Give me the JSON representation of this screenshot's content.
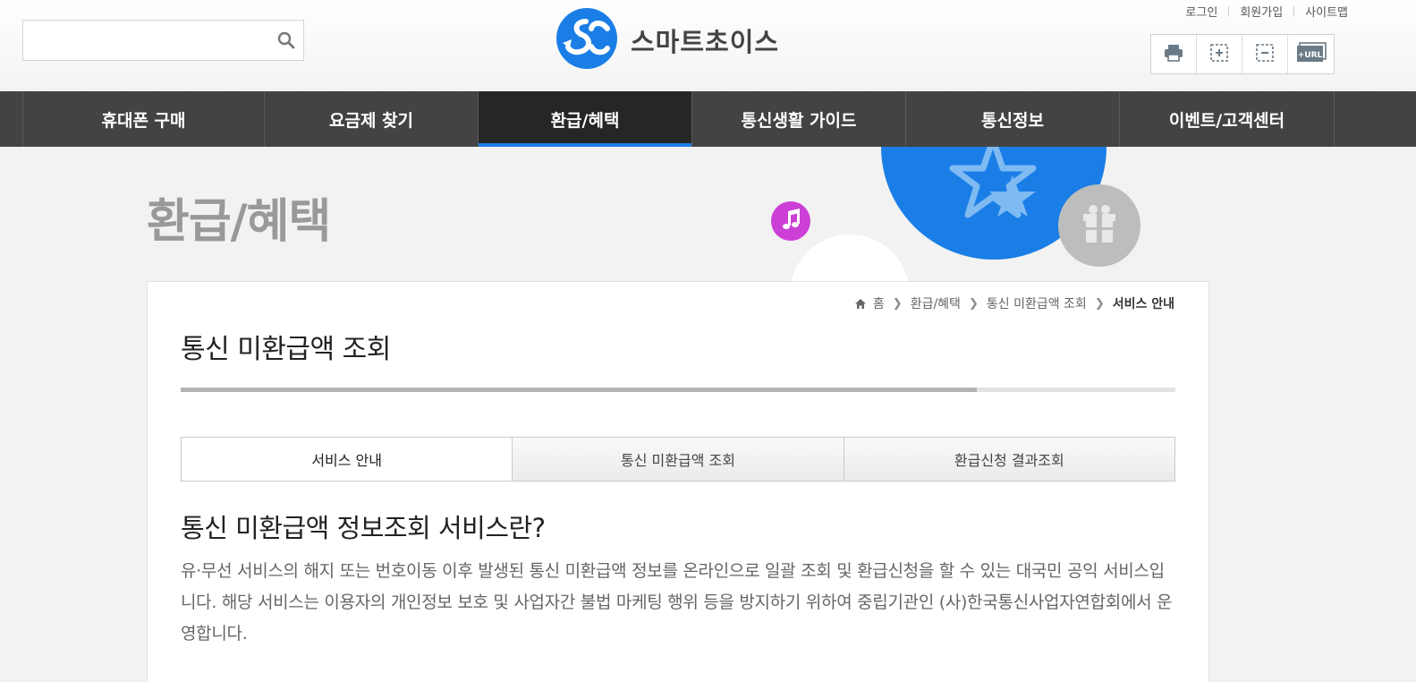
{
  "header": {
    "search": {
      "placeholder": "",
      "value": ""
    },
    "logo": {
      "text": "스마트초이스"
    },
    "util_links": [
      "로그인",
      "회원가입",
      "사이트맵"
    ],
    "tool_icons": [
      "print-icon",
      "zoom-in-icon",
      "zoom-out-icon",
      "url-copy-icon"
    ],
    "url_badge": "+URL"
  },
  "nav": {
    "items": [
      {
        "label": "휴대폰 구매"
      },
      {
        "label": "요금제 찾기"
      },
      {
        "label": "환급/혜택"
      },
      {
        "label": "통신생활 가이드"
      },
      {
        "label": "통신정보"
      },
      {
        "label": "이벤트/고객센터"
      }
    ],
    "active_index": 2
  },
  "visual": {
    "title": "환급/혜택"
  },
  "breadcrumb": {
    "items": [
      "홈",
      "환급/혜택",
      "통신 미환급액 조회",
      "서비스 안내"
    ]
  },
  "content": {
    "title": "통신 미환급액 조회",
    "progress": 0.8,
    "tabs": [
      {
        "label": "서비스 안내"
      },
      {
        "label": "통신 미환급액 조회"
      },
      {
        "label": "환급신청 결과조회"
      }
    ],
    "active_tab": 0,
    "section_title": "통신 미환급액 정보조회 서비스란?",
    "description": "유·무선 서비스의 해지 또는 번호이동 이후 발생된 통신 미환급액 정보를 온라인으로 일괄 조회 및 환급신청을 할 수 있는 대국민 공익 서비스입니다. 해당 서비스는 이용자의 개인정보 보호 및 사업자간 불법 마케팅 행위 등을 방지하기 위하여 중립기관인 (사)한국통신사업자연합회에서 운영합니다."
  },
  "colors": {
    "accent": "#1a7ee6",
    "nav_bg": "#434343",
    "nav_active": "#262626",
    "logo_blue": "#1a7ee6",
    "deco_purple": "#cc3fd6",
    "deco_gray": "#bdbdbd"
  }
}
